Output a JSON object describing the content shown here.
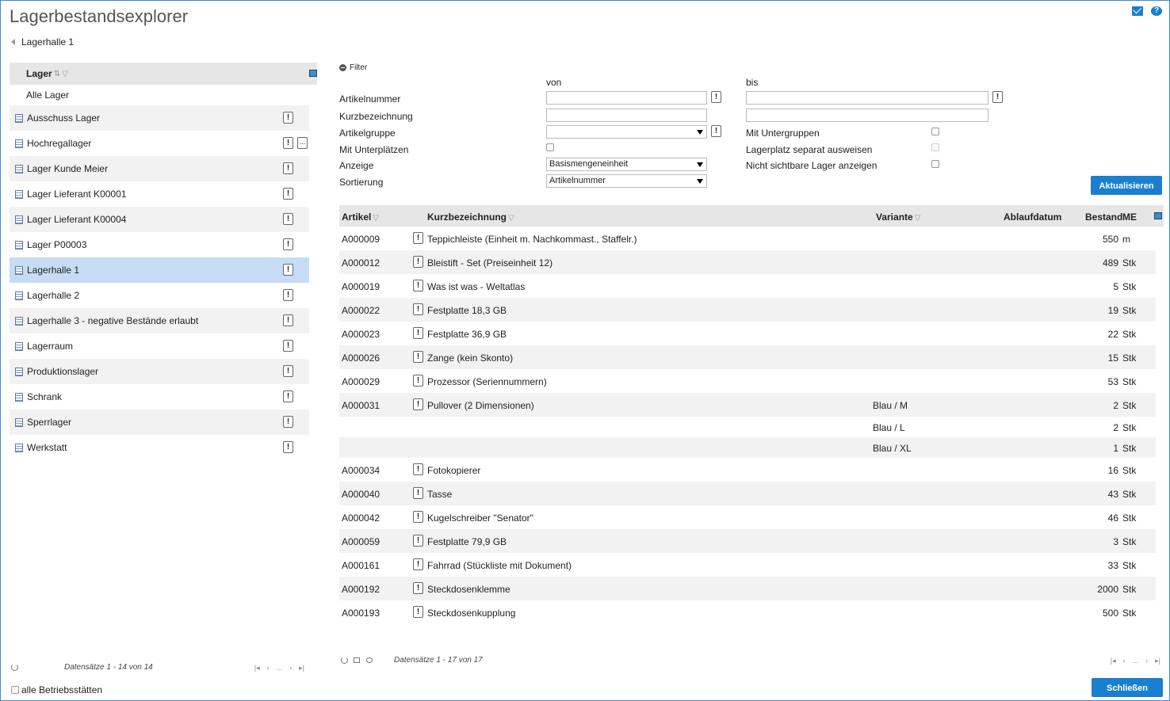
{
  "app": {
    "title": "Lagerbestandsexplorer"
  },
  "breadcrumb": {
    "label": "Lagerhalle 1"
  },
  "left": {
    "header": "Lager",
    "all_label": "Alle Lager",
    "items": [
      {
        "label": "Ausschuss Lager"
      },
      {
        "label": "Hochregallager"
      },
      {
        "label": "Lager Kunde Meier"
      },
      {
        "label": "Lager Lieferant K00001"
      },
      {
        "label": "Lager Lieferant K00004"
      },
      {
        "label": "Lager P00003"
      },
      {
        "label": "Lagerhalle 1"
      },
      {
        "label": "Lagerhalle 2"
      },
      {
        "label": "Lagerhalle 3 - negative Bestände erlaubt"
      },
      {
        "label": "Lagerraum"
      },
      {
        "label": "Produktionslager"
      },
      {
        "label": "Schrank"
      },
      {
        "label": "Sperrlager"
      },
      {
        "label": "Werkstatt"
      }
    ],
    "records": "Datensätze 1 - 14 von 14",
    "alle_label": "alle Betriebsstätten"
  },
  "filter": {
    "toggle_label": "Filter",
    "von": "von",
    "bis": "bis",
    "artikelnummer": "Artikelnummer",
    "kurzbezeichnung": "Kurzbezeichnung",
    "artikelgruppe": "Artikelgruppe",
    "mit_unterplaetzen": "Mit Unterplätzen",
    "anzeige": "Anzeige",
    "anzeige_value": "Basismengeneinheit",
    "sortierung": "Sortierung",
    "sortierung_value": "Artikelnummer",
    "mit_untergruppen": "Mit Untergruppen",
    "lagerplatz": "Lagerplatz separat ausweisen",
    "nicht_sichtbar": "Nicht sichtbare Lager anzeigen",
    "refresh_button": "Aktualisieren"
  },
  "table": {
    "headers": {
      "artikel": "Artikel",
      "kurz": "Kurzbezeichnung",
      "variante": "Variante",
      "ablauf": "Ablaufdatum",
      "bestand": "Bestand",
      "me": "ME"
    },
    "rows": [
      {
        "artikel": "A000009",
        "kurz": "Teppichleiste (Einheit m. Nachkommast., Staffelr.)",
        "variante": "",
        "bestand": "550",
        "me": "m"
      },
      {
        "artikel": "A000012",
        "kurz": "Bleistift - Set (Preiseinheit 12)",
        "variante": "",
        "bestand": "489",
        "me": "Stk"
      },
      {
        "artikel": "A000019",
        "kurz": "Was ist was - Weltatlas",
        "variante": "",
        "bestand": "5",
        "me": "Stk"
      },
      {
        "artikel": "A000022",
        "kurz": "Festplatte 18,3 GB",
        "variante": "",
        "bestand": "19",
        "me": "Stk"
      },
      {
        "artikel": "A000023",
        "kurz": "Festplatte 36,9 GB",
        "variante": "",
        "bestand": "22",
        "me": "Stk"
      },
      {
        "artikel": "A000026",
        "kurz": "Zange (kein Skonto)",
        "variante": "",
        "bestand": "15",
        "me": "Stk"
      },
      {
        "artikel": "A000029",
        "kurz": "Prozessor (Seriennummern)",
        "variante": "",
        "bestand": "53",
        "me": "Stk"
      },
      {
        "artikel": "A000031",
        "kurz": "Pullover (2 Dimensionen)",
        "variante": "Blau / M",
        "bestand": "2",
        "me": "Stk"
      },
      {
        "artikel": "",
        "kurz": "",
        "variante": "Blau / L",
        "bestand": "2",
        "me": "Stk"
      },
      {
        "artikel": "",
        "kurz": "",
        "variante": "Blau / XL",
        "bestand": "1",
        "me": "Stk"
      },
      {
        "artikel": "A000034",
        "kurz": "Fotokopierer",
        "variante": "",
        "bestand": "16",
        "me": "Stk"
      },
      {
        "artikel": "A000040",
        "kurz": "Tasse",
        "variante": "",
        "bestand": "43",
        "me": "Stk"
      },
      {
        "artikel": "A000042",
        "kurz": "Kugelschreiber \"Senator\"",
        "variante": "",
        "bestand": "46",
        "me": "Stk"
      },
      {
        "artikel": "A000059",
        "kurz": "Festplatte 79,9 GB",
        "variante": "",
        "bestand": "3",
        "me": "Stk"
      },
      {
        "artikel": "A000161",
        "kurz": "Fahrrad (Stückliste mit Dokument)",
        "variante": "",
        "bestand": "33",
        "me": "Stk"
      },
      {
        "artikel": "A000192",
        "kurz": "Steckdosenklemme",
        "variante": "",
        "bestand": "2000",
        "me": "Stk"
      },
      {
        "artikel": "A000193",
        "kurz": "Steckdosenkupplung",
        "variante": "",
        "bestand": "500",
        "me": "Stk"
      }
    ],
    "records": "Datensätze 1 - 17 von 17"
  },
  "pager": {
    "ellipsis": "..."
  },
  "close_button": "Schließen"
}
